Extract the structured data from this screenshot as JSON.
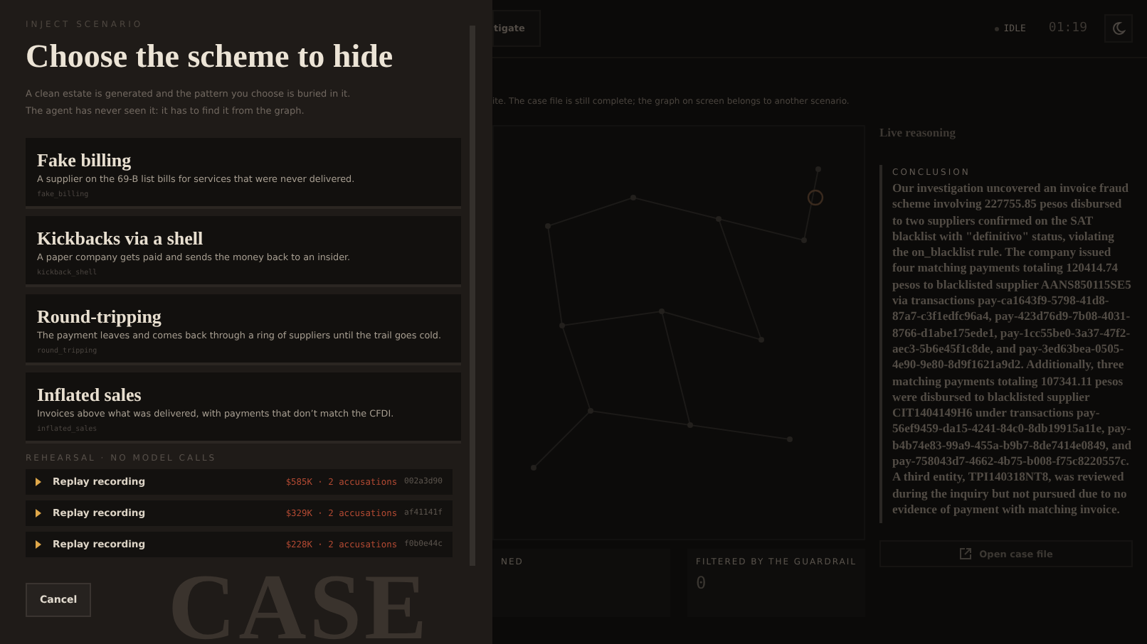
{
  "drawer": {
    "eyebrow": "INJECT SCENARIO",
    "title": "Choose the scheme to hide",
    "description": [
      "A clean estate is generated and the pattern you choose is buried in it.",
      "The agent has never seen it: it has to find it from the graph."
    ],
    "scenarios": [
      {
        "title": "Fake billing",
        "description": "A supplier on the 69-B list bills for services that were never delivered.",
        "code": "fake_billing"
      },
      {
        "title": "Kickbacks via a shell",
        "description": "A paper company gets paid and sends the money back to an insider.",
        "code": "kickback_shell"
      },
      {
        "title": "Round-tripping",
        "description": "The payment leaves and comes back through a ring of suppliers until the trail goes cold.",
        "code": "round_tripping"
      },
      {
        "title": "Inflated sales",
        "description": "Invoices above what was delivered, with payments that don’t match the CFDI.",
        "code": "inflated_sales"
      }
    ],
    "rehearsal_label": "REHEARSAL · NO MODEL CALLS",
    "recordings": [
      {
        "label": "Replay recording",
        "summary": "$585K · 2 accusations",
        "hash": "002a3d90"
      },
      {
        "label": "Replay recording",
        "summary": "$329K · 2 accusations",
        "hash": "af41141f"
      },
      {
        "label": "Replay recording",
        "summary": "$228K · 2 accusations",
        "hash": "f0b0e44c"
      }
    ],
    "cancel": "Cancel"
  },
  "background": {
    "backdrop_text": [
      "CASE"
    ],
    "tab": "tigate",
    "status": "IDLE",
    "timer": "01:19",
    "notice": "ite. The case file is still complete; the graph on screen belongs to another scenario.",
    "stats": [
      {
        "label": "NED"
      },
      {
        "label": "FILTERED BY THE GUARDRAIL",
        "value": "0"
      }
    ],
    "reasoning": {
      "title": "Live reasoning",
      "conclusion_label": "CONCLUSION",
      "conclusion": "Our investigation uncovered an invoice fraud scheme involving 227755.85 pesos disbursed to two suppliers confirmed on the SAT blacklist with \"definitivo\" status, violating the on_blacklist rule. The company issued four matching payments totaling 120414.74 pesos to blacklisted supplier AANS850115SE5 via transactions pay-ca1643f9-5798-41d8-87a7-c3f1edfc96a4, pay-423d76d9-7b08-4031-8766-d1abe175ede1, pay-1cc55be0-3a37-47f2-aec3-5b6e45f1c8de, and pay-3ed63bea-0505-4e90-9e80-8d9f1621a9d2. Additionally, three matching payments totaling 107341.11 pesos were disbursed to blacklisted supplier CIT1404149H6 under transactions pay-56ef9459-da15-4241-84c0-8db19915a11e, pay-b4b74e83-99a9-455a-b9b7-8de7414e0849, and pay-758043d7-4662-4b75-b008-f75c8220557c. A third entity, TPI140318NT8, was reviewed during the inquiry but not pursued due to no evidence of payment with matching invoice.",
      "open_button": "Open case file"
    }
  }
}
